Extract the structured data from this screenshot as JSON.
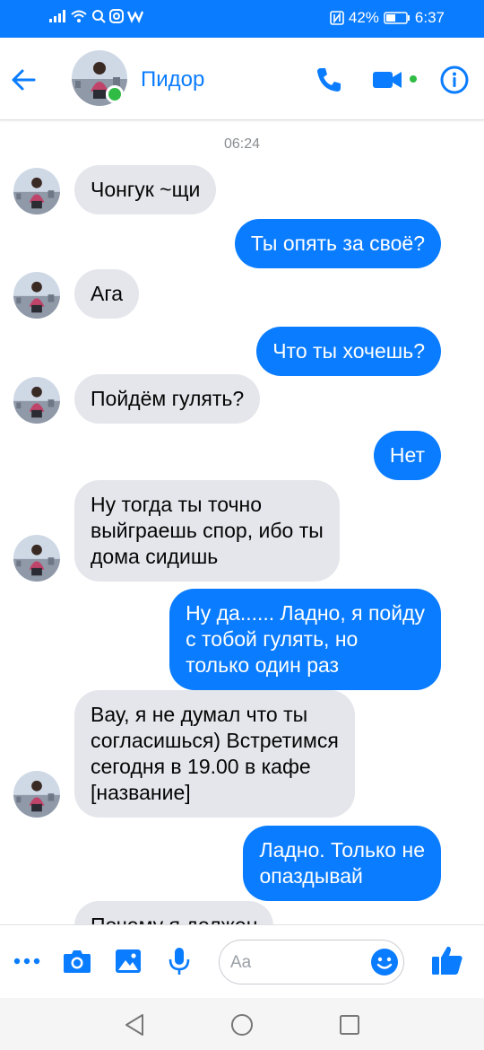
{
  "status_bar": {
    "battery": "42%",
    "time": "6:37",
    "icons": [
      "signal-icon",
      "wifi-icon",
      "search-icon",
      "instagram-icon",
      "w-app-icon",
      "nfc-icon",
      "battery-icon"
    ]
  },
  "header": {
    "contact_name": "Пидор",
    "online": true,
    "icons": [
      "back-arrow-icon",
      "phone-icon",
      "video-camera-icon",
      "info-icon"
    ]
  },
  "chat": {
    "timestamp": "06:24",
    "messages": [
      {
        "from": "them",
        "lines": [
          "Чонгук ~щи"
        ]
      },
      {
        "from": "me",
        "lines": [
          "Ты опять за своё?"
        ]
      },
      {
        "from": "them",
        "lines": [
          "Ага"
        ]
      },
      {
        "from": "me",
        "lines": [
          "Что ты хочешь?"
        ]
      },
      {
        "from": "them",
        "lines": [
          "Пойдём гулять?"
        ]
      },
      {
        "from": "me",
        "lines": [
          "Нет"
        ]
      },
      {
        "from": "them",
        "lines": [
          "Ну тогда ты точно",
          "выйграешь спор, ибо ты",
          "дома сидишь"
        ]
      },
      {
        "from": "me",
        "lines": [
          "Ну да...... Ладно, я пойду",
          "с тобой гулять, но",
          "только один раз"
        ]
      },
      {
        "from": "them",
        "lines": [
          "Вау, я не думал что ты",
          "согласишься) Встретимся",
          "сегодня в 19.00 в кафе",
          "[название]"
        ]
      },
      {
        "from": "me",
        "lines": [
          "Ладно. Только не",
          "опаздывай"
        ]
      },
      {
        "from": "them",
        "lines": [
          "Почему я должен"
        ]
      }
    ]
  },
  "composer": {
    "placeholder": "Aa",
    "icons": [
      "more-icon",
      "camera-icon",
      "gallery-icon",
      "microphone-icon",
      "emoji-icon",
      "thumbs-up-icon"
    ]
  },
  "nav": {
    "icons": [
      "back-triangle-icon",
      "home-circle-icon",
      "recents-square-icon"
    ]
  },
  "colors": {
    "accent": "#0a7cff",
    "incoming_bubble": "#e4e6eb",
    "online": "#2fbb44"
  }
}
